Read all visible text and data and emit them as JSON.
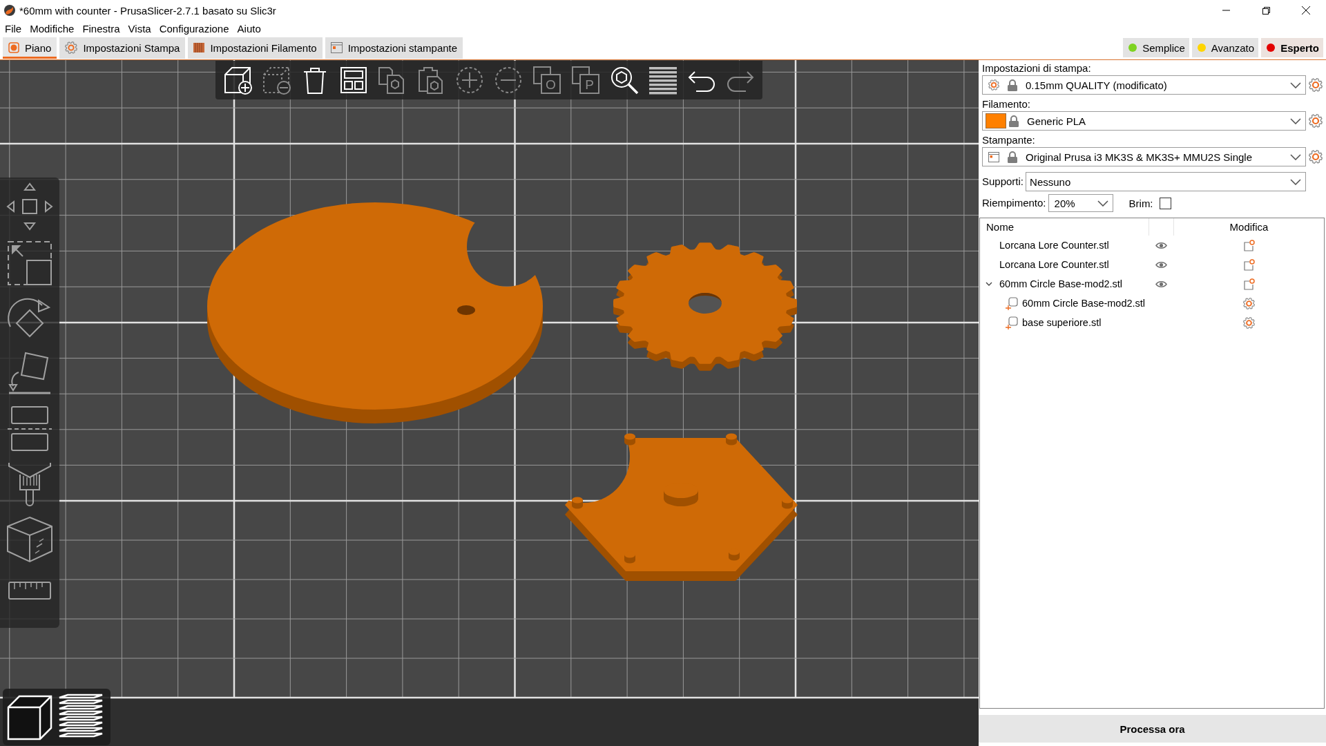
{
  "window": {
    "title": "*60mm with counter - PrusaSlicer-2.7.1 basato su Slic3r"
  },
  "menu": [
    "File",
    "Modifiche",
    "Finestra",
    "Vista",
    "Configurazione",
    "Aiuto"
  ],
  "tabs": [
    {
      "label": "Piano",
      "selected": true
    },
    {
      "label": "Impostazioni Stampa",
      "selected": false
    },
    {
      "label": "Impostazioni Filamento",
      "selected": false
    },
    {
      "label": "Impostazioni stampante",
      "selected": false
    }
  ],
  "modes": [
    {
      "label": "Semplice",
      "color": "#7ed321",
      "selected": false
    },
    {
      "label": "Avanzato",
      "color": "#ffd500",
      "selected": false
    },
    {
      "label": "Esperto",
      "color": "#e30000",
      "selected": true
    }
  ],
  "toolbar": [
    {
      "kind": "add",
      "disabled": false
    },
    {
      "kind": "delete",
      "disabled": true
    },
    {
      "kind": "delete_all",
      "disabled": false
    },
    {
      "kind": "arrange",
      "disabled": false
    },
    {
      "kind": "copy",
      "disabled": true
    },
    {
      "kind": "paste",
      "disabled": true
    },
    {
      "kind": "add_instance",
      "disabled": true
    },
    {
      "kind": "remove_instance",
      "disabled": true
    },
    {
      "kind": "split_objects",
      "disabled": true,
      "glyph": "O"
    },
    {
      "kind": "split_parts",
      "disabled": true,
      "glyph": "P"
    },
    {
      "kind": "search",
      "disabled": false
    },
    {
      "kind": "layers",
      "disabled": false
    },
    {
      "kind": "undo",
      "disabled": false
    },
    {
      "kind": "redo",
      "disabled": true
    }
  ],
  "sidebar": {
    "print": {
      "label": "Impostazioni di stampa:",
      "value": "0.15mm QUALITY (modificato)"
    },
    "filament": {
      "label": "Filamento:",
      "value": "Generic PLA",
      "color": "#ff8000"
    },
    "printer": {
      "label": "Stampante:",
      "value": "Original Prusa i3 MK3S & MK3S+ MMU2S Single"
    },
    "supports": {
      "label": "Supporti:",
      "value": "Nessuno"
    },
    "infill": {
      "label": "Riempimento:",
      "value": "20%"
    },
    "brim": {
      "label": "Brim:",
      "checked": false
    },
    "objects": {
      "columns": [
        "Nome",
        "Modifica"
      ],
      "items": [
        {
          "name": "Lorcana Lore Counter.stl"
        },
        {
          "name": "Lorcana Lore Counter.stl"
        },
        {
          "name": "60mm Circle Base-mod2.stl",
          "expanded": true,
          "children": [
            {
              "name": "60mm Circle Base-mod2.stl"
            },
            {
              "name": "base superiore.stl"
            }
          ]
        }
      ]
    },
    "process_button": "Processa ora"
  }
}
